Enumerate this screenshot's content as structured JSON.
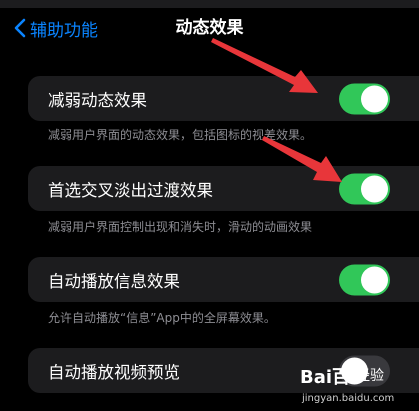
{
  "nav": {
    "back_label": "辅助功能",
    "title": "动态效果"
  },
  "rows": [
    {
      "label": "减弱动态效果",
      "enabled": true,
      "footer": "减弱用户界面的动态效果，包括图标的视差效果。"
    },
    {
      "label": "首选交叉淡出过渡效果",
      "enabled": true,
      "footer": "减弱用户界面控制出现和消失时，滑动的动画效果"
    },
    {
      "label": "自动播放信息效果",
      "enabled": true,
      "footer": "允许自动播放“信息”App中的全屏幕效果。"
    },
    {
      "label": "自动播放视频预览",
      "enabled": false
    }
  ],
  "watermark": {
    "brand": "Bai百",
    "text": "经验",
    "url": "jingyan.baidu.com"
  },
  "colors": {
    "background": "#000000",
    "cell": "#1c1c1e",
    "accent_blue": "#0a84ff",
    "toggle_on": "#31c759",
    "toggle_off": "#39393d",
    "annotation_arrow": "#e8363a",
    "footer_text": "#8d8d93"
  }
}
